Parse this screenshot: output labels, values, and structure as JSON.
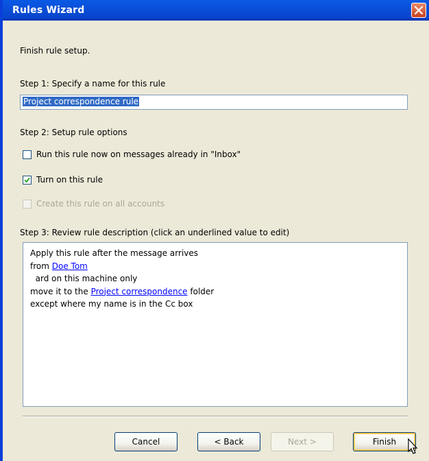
{
  "window": {
    "title": "Rules Wizard"
  },
  "intro": "Finish rule setup.",
  "step1": {
    "label": "Step 1: Specify a name for this rule",
    "value": "Project correspondence rule"
  },
  "step2": {
    "label": "Step 2: Setup rule options",
    "options": [
      {
        "label": "Run this rule now on messages already in \"Inbox\"",
        "checked": false,
        "enabled": true
      },
      {
        "label": "Turn on this rule",
        "checked": true,
        "enabled": true
      },
      {
        "label": "Create this rule on all accounts",
        "checked": false,
        "enabled": false
      }
    ]
  },
  "step3": {
    "label": "Step 3: Review rule description (click an underlined value to edit)",
    "lines": {
      "l1": "Apply this rule after the message arrives",
      "l2_prefix": "from ",
      "l2_link": "Doe Tom",
      "l3": "  ard on this machine only",
      "l4_prefix": "move it to the ",
      "l4_link": "Project correspondence",
      "l4_suffix": " folder",
      "l5": "except where my name is in the Cc box"
    }
  },
  "buttons": {
    "cancel": "Cancel",
    "back": "< Back",
    "next": "Next >",
    "finish": "Finish"
  },
  "colors": {
    "titlebar": "#0a4fda",
    "client": "#ece9d8",
    "selection": "#316ac5",
    "link": "#0000ff"
  }
}
